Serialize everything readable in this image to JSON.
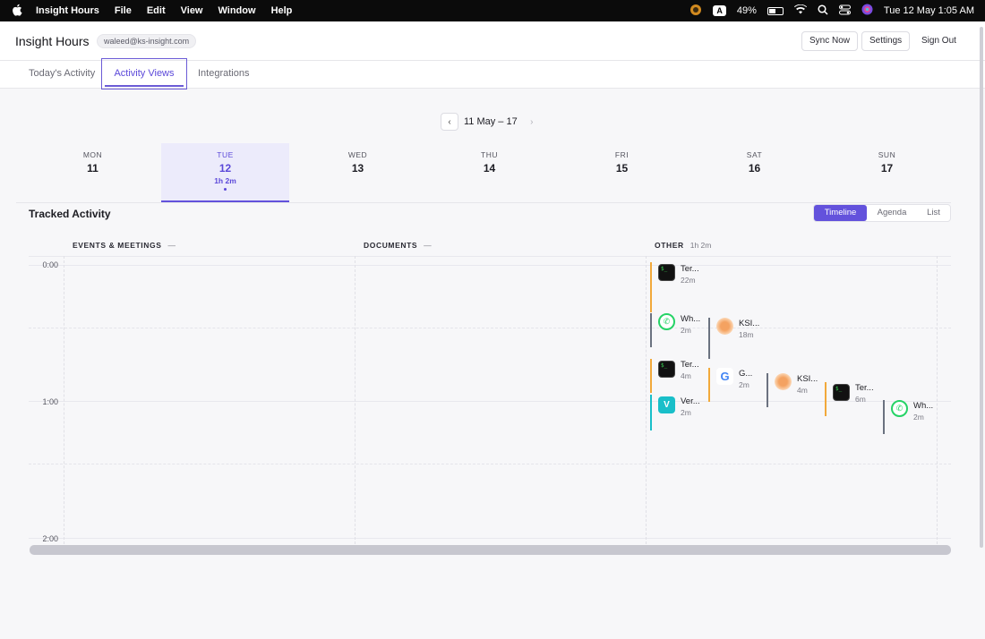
{
  "menubar": {
    "app_name": "Insight Hours",
    "menus": [
      "File",
      "Edit",
      "View",
      "Window",
      "Help"
    ],
    "input_badge": "A",
    "battery": "49%",
    "datetime": "Tue 12 May  1:05 AM"
  },
  "header": {
    "title": "Insight Hours",
    "email": "waleed@ks-insight.com",
    "sync_label": "Sync Now",
    "settings_label": "Settings",
    "signout_label": "Sign Out"
  },
  "tabs": {
    "today": "Today's Activity",
    "views": "Activity Views",
    "integrations": "Integrations",
    "active": "Activity Views"
  },
  "date_nav": {
    "prev": "‹",
    "next": "›",
    "range": "11 May – 17"
  },
  "week": [
    {
      "dow": "MON",
      "num": "11"
    },
    {
      "dow": "TUE",
      "num": "12",
      "duration": "1h 2m",
      "active": true
    },
    {
      "dow": "WED",
      "num": "13"
    },
    {
      "dow": "THU",
      "num": "14"
    },
    {
      "dow": "FRI",
      "num": "15"
    },
    {
      "dow": "SAT",
      "num": "16"
    },
    {
      "dow": "SUN",
      "num": "17"
    }
  ],
  "tracked": {
    "title": "Tracked Activity",
    "views": [
      "Timeline",
      "Agenda",
      "List"
    ],
    "active_view": "Timeline"
  },
  "columns": {
    "events": {
      "label": "EVENTS & MEETINGS",
      "value": "—"
    },
    "documents": {
      "label": "DOCUMENTS",
      "value": "—"
    },
    "other": {
      "label": "OTHER",
      "value": "1h 2m"
    }
  },
  "time_labels": [
    "0:00",
    "1:00",
    "2:00"
  ],
  "events": [
    {
      "name": "Ter...",
      "duration": "22m",
      "icon": "terminal-icon",
      "color": "#f2a93b"
    },
    {
      "name": "Wh...",
      "duration": "2m",
      "icon": "whatsapp-icon",
      "color": "#6b7280"
    },
    {
      "name": "KSI...",
      "duration": "18m",
      "icon": "ksi-icon",
      "color": "#6b7280"
    },
    {
      "name": "Ter...",
      "duration": "4m",
      "icon": "terminal-icon",
      "color": "#f2a93b"
    },
    {
      "name": "G...",
      "duration": "2m",
      "icon": "google-icon",
      "color": "#f2a93b"
    },
    {
      "name": "KSI...",
      "duration": "4m",
      "icon": "ksi-icon",
      "color": "#6b7280"
    },
    {
      "name": "Ter...",
      "duration": "6m",
      "icon": "terminal-icon",
      "color": "#f2a93b"
    },
    {
      "name": "Ver...",
      "duration": "2m",
      "icon": "vercel-icon",
      "color": "#19bfc9"
    },
    {
      "name": "Wh...",
      "duration": "2m",
      "icon": "whatsapp-icon",
      "color": "#6b7280"
    }
  ]
}
